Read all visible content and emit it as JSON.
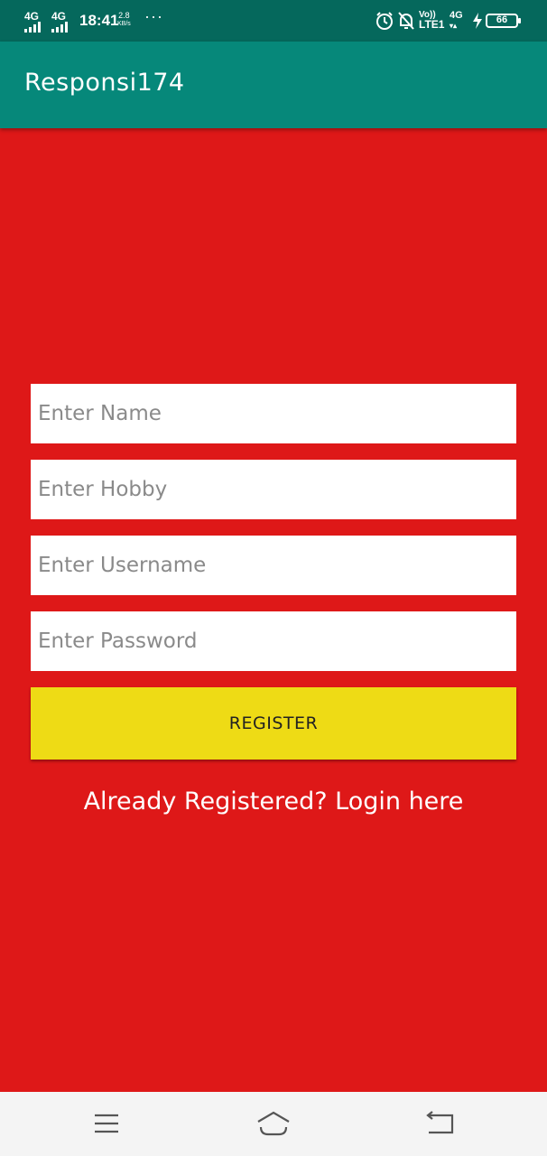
{
  "status_bar": {
    "sim1": "4G",
    "sim2": "4G",
    "time": "18:41",
    "speed_value": "2.8",
    "speed_unit": "KB/s",
    "more_dots": "···",
    "volte": "Vo))",
    "lte": "LTE1",
    "net2": "4G",
    "battery": "66",
    "icons": [
      "alarm-icon",
      "mute-icon",
      "charging-icon"
    ]
  },
  "app_bar": {
    "title": "Responsi174"
  },
  "form": {
    "name_placeholder": "Enter Name",
    "hobby_placeholder": "Enter Hobby",
    "username_placeholder": "Enter Username",
    "password_placeholder": "Enter Password",
    "register_label": "REGISTER",
    "login_link": "Already Registered? Login here"
  },
  "colors": {
    "background": "#DE1818",
    "app_bar": "#06887A",
    "status_bar": "#05685C",
    "button": "#EEDB15",
    "nav_bar": "#F4F4F4"
  },
  "nav_bar": {
    "icons": [
      "menu-icon",
      "home-icon",
      "back-icon"
    ]
  }
}
